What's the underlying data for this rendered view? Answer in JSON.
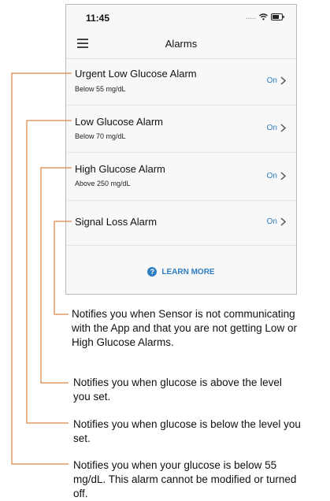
{
  "status_bar": {
    "time": "11:45",
    "signal": "....."
  },
  "header": {
    "title": "Alarms"
  },
  "alarms": [
    {
      "name": "Urgent Low Glucose Alarm",
      "detail": "Below 55 mg/dL",
      "status": "On"
    },
    {
      "name": "Low Glucose Alarm",
      "detail": "Below 70 mg/dL",
      "status": "On"
    },
    {
      "name": "High Glucose Alarm",
      "detail": "Above 250 mg/dL",
      "status": "On"
    },
    {
      "name": "Signal Loss Alarm",
      "detail": "",
      "status": "On"
    }
  ],
  "learn_more": {
    "label": "LEARN MORE",
    "icon": "question-circle-icon"
  },
  "callouts": [
    {
      "text": "Notifies you when Sensor is not communicating with the App and that you are not getting Low or High Glucose Alarms."
    },
    {
      "text": "Notifies you when glucose is above the level you set."
    },
    {
      "text": "Notifies you when glucose is below the level you set."
    },
    {
      "text": "Notifies you when your glucose is below 55 mg/dL. This alarm cannot be modified or turned off."
    }
  ],
  "colors": {
    "accent": "#2f7ec1",
    "callout_line": "#d2691e"
  }
}
